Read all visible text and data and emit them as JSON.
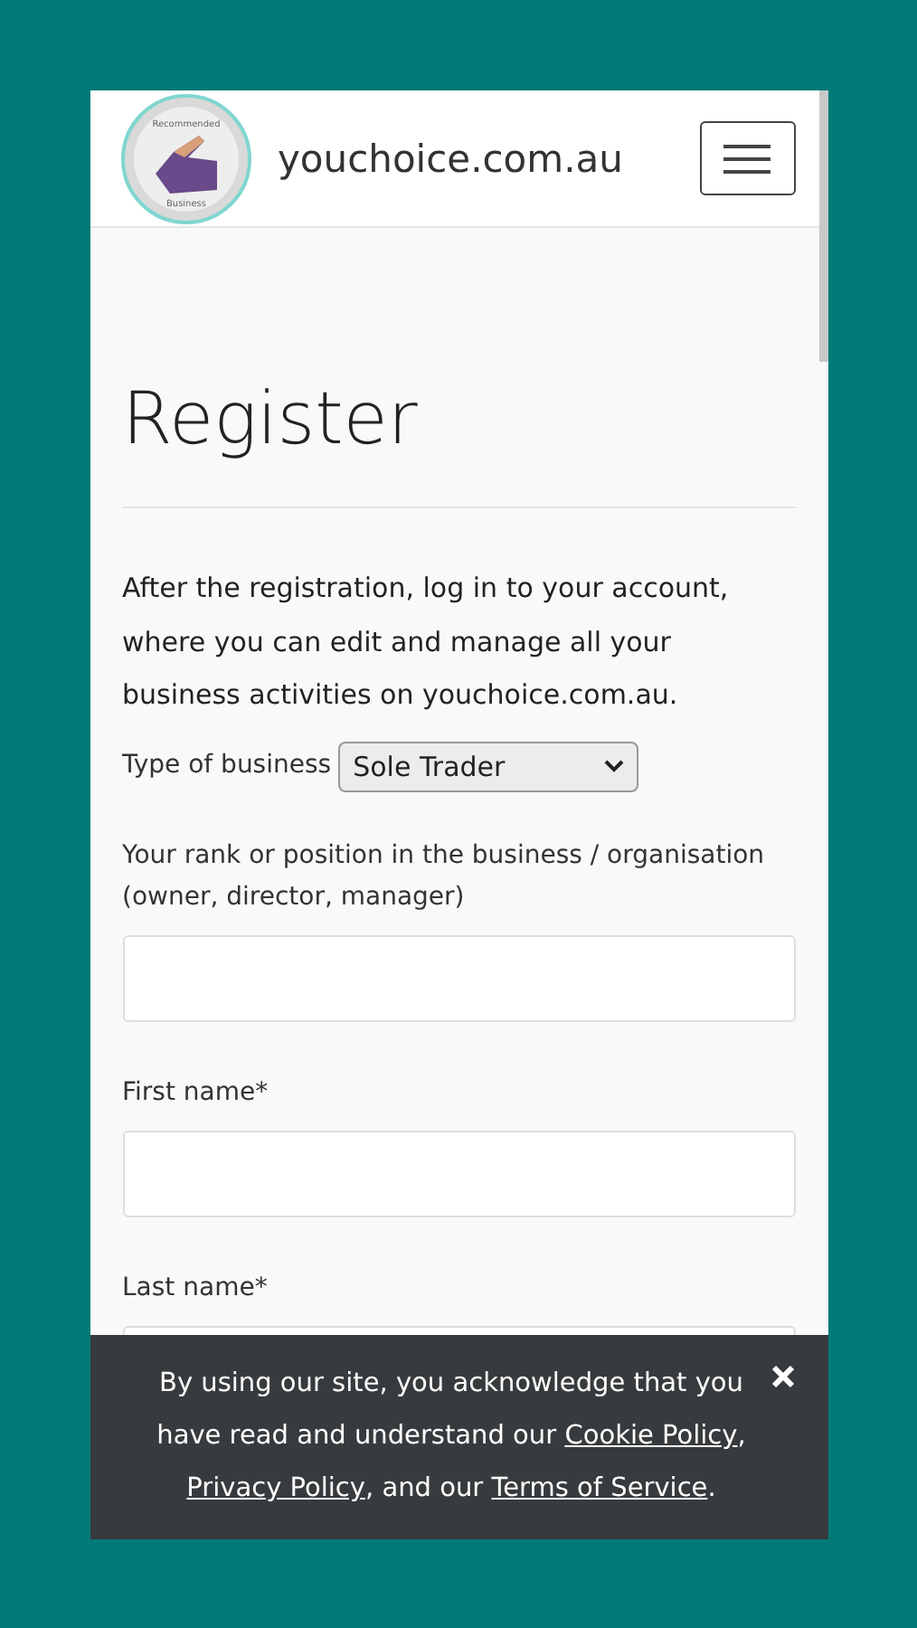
{
  "header": {
    "logo": {
      "top_text": "Recommended",
      "bottom_text": "Business"
    },
    "site_name": "youchoice.com.au"
  },
  "page": {
    "title": "Register",
    "intro": "After the registration, log in to your account, where you can edit and manage all your business activities on youchoice.com.au.",
    "business_type": {
      "label": "Type of business",
      "value": "Sole Trader"
    },
    "fields": [
      {
        "label": "Your rank or position in the business / organisation (owner, director, manager)"
      },
      {
        "label": "First name*"
      },
      {
        "label": "Last name*"
      }
    ]
  },
  "cookie_banner": {
    "text_before": "By using our site, you acknowledge that you have read and understand our",
    "links": [
      "Cookie Policy",
      "Privacy Policy",
      "Terms of Service"
    ],
    "separators": [
      ",",
      ", and our",
      "."
    ]
  }
}
